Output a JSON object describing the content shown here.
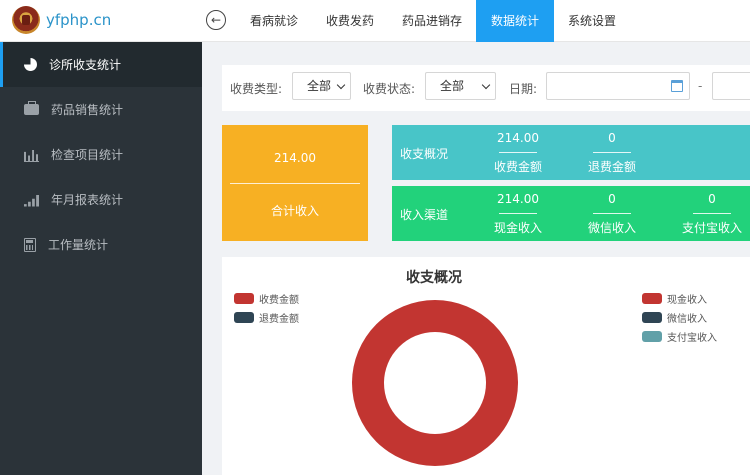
{
  "header": {
    "brand": "yfphp.cn",
    "back_icon": "arrow-left-circle-icon",
    "nav": [
      {
        "label": "看病就诊"
      },
      {
        "label": "收费发药"
      },
      {
        "label": "药品进销存"
      },
      {
        "label": "数据统计",
        "active": true
      },
      {
        "label": "系统设置"
      }
    ],
    "accent": "#1e9ff2"
  },
  "sidebar": {
    "items": [
      {
        "label": "诊所收支统计",
        "icon": "pie-chart-icon",
        "active": true
      },
      {
        "label": "药品销售统计",
        "icon": "briefcase-icon"
      },
      {
        "label": "检查项目统计",
        "icon": "bar-chart-icon"
      },
      {
        "label": "年月报表统计",
        "icon": "signal-bars-icon"
      },
      {
        "label": "工作量统计",
        "icon": "calculator-icon"
      }
    ]
  },
  "filter": {
    "fee_type_label": "收费类型:",
    "fee_type_value": "全部",
    "fee_status_label": "收费状态:",
    "fee_status_value": "全部",
    "date_label": "日期:",
    "date_separator": "-"
  },
  "total": {
    "value": "214.00",
    "label": "合计收入",
    "color": "#f7b023"
  },
  "income_overview": {
    "title": "收支概况",
    "color": "#48c5c8",
    "cells": [
      {
        "value": "214.00",
        "label": "收费金额"
      },
      {
        "value": "0",
        "label": "退费金额"
      }
    ]
  },
  "income_channel": {
    "title": "收入渠道",
    "color": "#22d27b",
    "cells": [
      {
        "value": "214.00",
        "label": "现金收入"
      },
      {
        "value": "0",
        "label": "微信收入"
      },
      {
        "value": "0",
        "label": "支付宝收入"
      }
    ]
  },
  "chart_data": {
    "type": "pie",
    "title": "收支概况",
    "legends": [
      {
        "placement": "top-left",
        "entries": [
          {
            "name": "收费金额",
            "color": "#c23531"
          },
          {
            "name": "退费金额",
            "color": "#2f4554"
          }
        ]
      },
      {
        "placement": "top-right",
        "entries": [
          {
            "name": "现金收入",
            "color": "#c23531"
          },
          {
            "name": "微信收入",
            "color": "#2f4554"
          },
          {
            "name": "支付宝收入",
            "color": "#61a0a8"
          }
        ]
      }
    ],
    "series": [
      {
        "values": [
          214.0,
          0
        ]
      }
    ],
    "categories": [
      "收费金额",
      "退费金额"
    ]
  }
}
